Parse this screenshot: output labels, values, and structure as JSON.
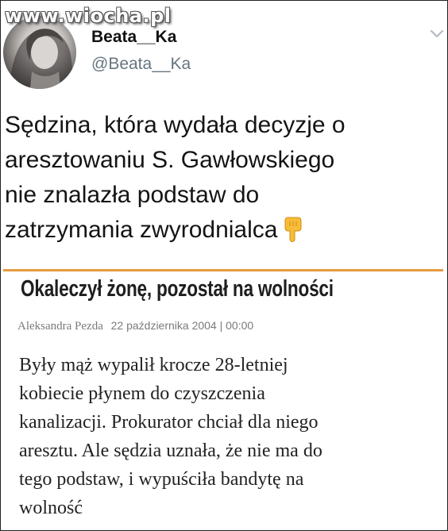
{
  "watermark": "www.wiocha.pl",
  "tweet": {
    "display_name": "Beata__Ka",
    "handle": "@Beata__Ka",
    "text_lines": [
      "Sędzina, która wydała decyzje o",
      "aresztowaniu S. Gawłowskiego",
      "nie znalazła podstaw do",
      "zatrzymania zwyrodnialca"
    ],
    "emoji": "pointing-down-hand-icon"
  },
  "article": {
    "headline": "Okaleczył żonę, pozostał na wolności",
    "author": "Aleksandra Pezda",
    "date": "22 października 2004 | 00:00",
    "body_lines": [
      "Były mąż wypalił krocze 28-letniej",
      "kobiecie płynem do czyszczenia",
      "kanalizacji. Prokurator chciał dla niego",
      "aresztu. Ale sędzia uznała, że nie ma do",
      "tego podstaw, i wypuściła bandytę na",
      "wolność"
    ],
    "accent_color": "#e59a3e"
  },
  "colors": {
    "handle": "#66757f",
    "text": "#141414"
  }
}
